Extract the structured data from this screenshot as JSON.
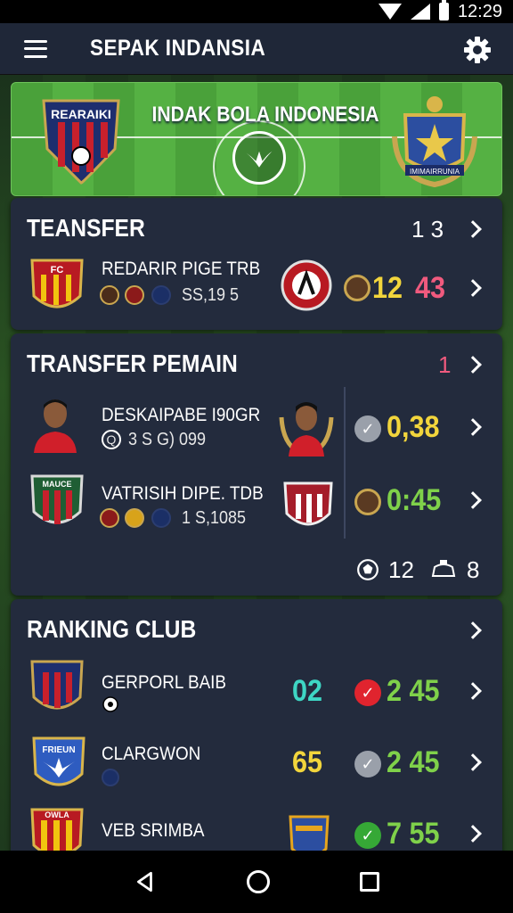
{
  "status_bar": {
    "time": "12:29"
  },
  "app_bar": {
    "title": "SEPAK INDANSIA"
  },
  "banner": {
    "title": "INDAK BOLA INDONESIA",
    "left_crest_text": "REARAIKI",
    "right_crest_text": "IMIMAIRRUNIA"
  },
  "transfer_card": {
    "title": "TEANSFER",
    "count": "1 3",
    "row": {
      "name": "REDARIR PIGE TRB",
      "sub": "SS,19 5",
      "score_home": "12",
      "score_away": "43",
      "crest_text": "FC"
    }
  },
  "transfer_pemain_card": {
    "title": "TRANSFER PEMAIN",
    "count": "1",
    "rows": [
      {
        "name": "DESKAIPABE I90GR",
        "sub": "3  S  G)  099",
        "prefix": "Q",
        "score": "0,38"
      },
      {
        "name": "VATRISIH DIPE. TDB",
        "sub": "1 S,1085",
        "score": "0:45",
        "crest_text": "MAUCE"
      }
    ],
    "footer": {
      "left_count": "12",
      "right_count": "8"
    }
  },
  "ranking_card": {
    "title": "RANKING CLUB",
    "rows": [
      {
        "name": "GERPORL BAIB",
        "rank": "02",
        "score": "2 45"
      },
      {
        "name": "CLARGWON",
        "rank": "65",
        "score": "2 45",
        "crest_text": "FRIEUN"
      },
      {
        "name": "VEB SRIMBA",
        "score": "7 55",
        "crest_text": "OWLA"
      }
    ]
  },
  "colors": {
    "yellow": "#f2d53c",
    "green": "#7fd14a",
    "pink": "#f05a7e",
    "teal": "#3ed6c4",
    "red_check": "#e0242e",
    "green_check": "#36a836"
  }
}
